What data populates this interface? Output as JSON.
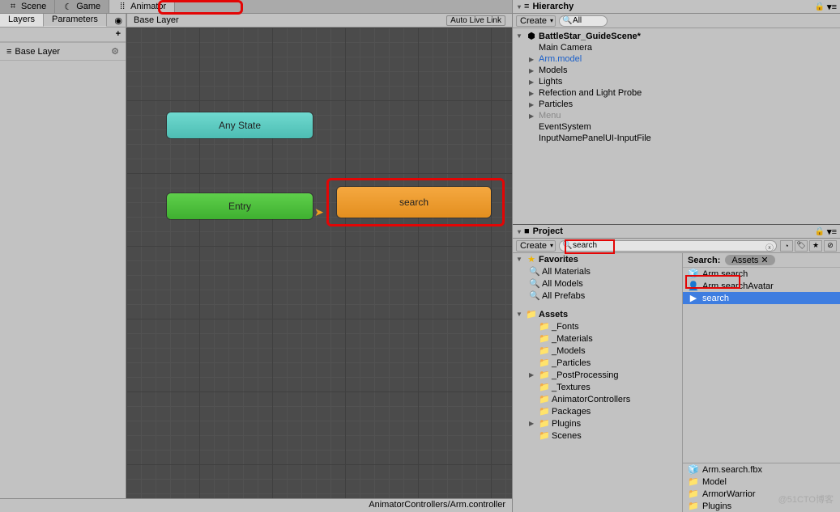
{
  "top_tabs": {
    "scene": "Scene",
    "game": "Game",
    "animator": "Animator"
  },
  "animator": {
    "tabs": {
      "layers": "Layers",
      "parameters": "Parameters"
    },
    "breadcrumb": "Base Layer",
    "live_link": "Auto Live Link",
    "layer_row": "Base Layer",
    "nodes": {
      "anystate": "Any State",
      "entry": "Entry",
      "search": "search"
    },
    "footer": "AnimatorControllers/Arm.controller"
  },
  "hierarchy": {
    "title": "Hierarchy",
    "create": "Create",
    "all_filter": "All",
    "scene": "BattleStar_GuideScene*",
    "items": [
      {
        "label": "Main Camera",
        "cls": ""
      },
      {
        "label": "Arm.model",
        "cls": "blue-text",
        "arr": "▶"
      },
      {
        "label": "Models",
        "cls": "",
        "arr": "▶"
      },
      {
        "label": "Lights",
        "cls": "",
        "arr": "▶"
      },
      {
        "label": "Refection and Light Probe",
        "cls": "",
        "arr": "▶"
      },
      {
        "label": "Particles",
        "cls": "",
        "arr": "▶"
      },
      {
        "label": "Menu",
        "cls": "grey-text",
        "arr": "▶"
      },
      {
        "label": "EventSystem",
        "cls": ""
      },
      {
        "label": "InputNamePanelUI-InputFile",
        "cls": ""
      }
    ]
  },
  "project": {
    "title": "Project",
    "create": "Create",
    "search_value": "search",
    "favorites": "Favorites",
    "fav_items": [
      "All Materials",
      "All Models",
      "All Prefabs"
    ],
    "assets": "Assets",
    "asset_folders": [
      "_Fonts",
      "_Materials",
      "_Models",
      "_Particles",
      "_PostProcessing",
      "_Textures",
      "AnimatorControllers",
      "Packages",
      "Plugins",
      "Scenes"
    ],
    "search_label": "Search:",
    "assets_pill": "Assets",
    "results": [
      {
        "label": "Arm.search",
        "ico": "🧊"
      },
      {
        "label": "Arm.searchAvatar",
        "ico": "👤"
      },
      {
        "label": "search",
        "ico": "▶",
        "selected": true
      }
    ],
    "footer": [
      {
        "label": "Arm.search.fbx",
        "ico": "🧊"
      },
      {
        "label": "Model",
        "ico": "📁"
      },
      {
        "label": "ArmorWarrior",
        "ico": "📁"
      },
      {
        "label": "Plugins",
        "ico": "📁"
      }
    ]
  },
  "watermark": "@51CTO博客"
}
